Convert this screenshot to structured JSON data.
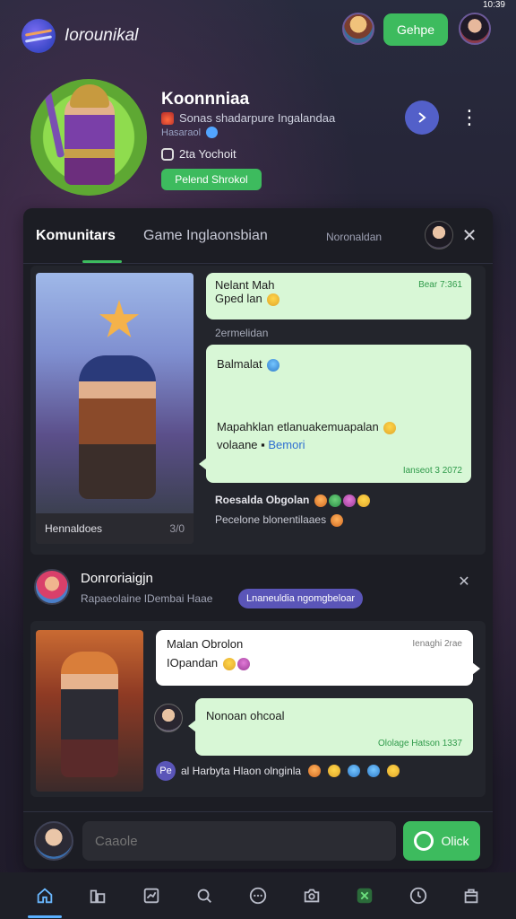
{
  "status": {
    "time": "10:39"
  },
  "top_bar": {
    "app_title": "Iorounikal",
    "join_label": "Gehpe"
  },
  "profile": {
    "name": "Koonnniaa",
    "line1": "Sonas shadarpure Ingalandaa",
    "line2": "Hasaraol",
    "line3": "2ta Yochoit",
    "follow_label": "Pelend Shrokol"
  },
  "tabs": [
    {
      "label": "Komunitars"
    },
    {
      "label": "Game Inglaonsbian"
    },
    {
      "label": "Noronaldan"
    }
  ],
  "section1": {
    "art_caption": "Hennaldoes",
    "art_count": "3/0",
    "msg1": {
      "text_a": "Nelant Mah",
      "text_b": "Gped lan",
      "time": "Bear 7:361"
    },
    "mid_label": "2ermelidan",
    "msg2": {
      "head": "Balmalat",
      "body_a": "Mapahklan etlanuakemuapalan",
      "body_b": "volaane",
      "link": "Bemori",
      "time": "Ianseot 3 2072"
    },
    "react1": "Roesalda Obgolan",
    "react2": "Pecelone blonentilaaes"
  },
  "section2": {
    "title": "Donroriaigjn",
    "subtitle": "Rapaeolaine IDembai Haae",
    "tag": "Lnaneuldia ngomgbeloar",
    "msg1": {
      "line1": "Malan Obrolon",
      "line2": "IOpandan",
      "time": "Ienaghi 2rae"
    },
    "msg2": {
      "text": "Nonoan ohcoal",
      "time": "Ololage Hatson 1337"
    },
    "react_prefix": "Pe",
    "react_text": "al Harbyta Hlaon olnginla"
  },
  "composer": {
    "placeholder": "Caaole",
    "send_label": "Olick"
  },
  "nav": [
    "home-icon",
    "library-icon",
    "chart-icon",
    "explore-icon",
    "chat-icon",
    "camera-icon",
    "game-icon",
    "clock-icon",
    "bag-icon"
  ],
  "colors": {
    "accent_green": "#3dbb5e",
    "accent_purple": "#5a55b8",
    "bubble_green": "#d8f7d6"
  }
}
